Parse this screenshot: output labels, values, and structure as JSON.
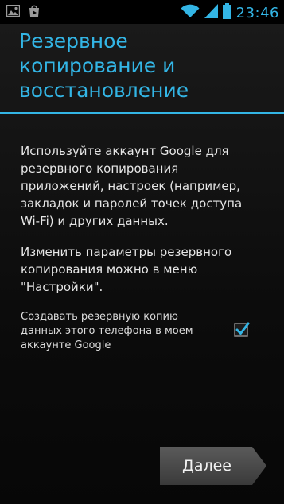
{
  "status_bar": {
    "time": "23:46",
    "left_icons": [
      "image-icon",
      "play-store-icon"
    ],
    "right_icons": [
      "wifi-icon",
      "signal-icon",
      "battery-icon"
    ],
    "accent_color": "#33b5e5"
  },
  "screen": {
    "title": "Резервное\nкопирование и\nвосстановление",
    "paragraph_1": "Используйте аккаунт Google для\nрезервного копирования\nприложений, настроек (например,\nзакладок и паролей точек доступа\nWi-Fi) и других данных.",
    "paragraph_2": "Изменить параметры резервного\nкопирования можно в меню\n\"Настройки\".",
    "backup_checkbox": {
      "label": "Создавать резервную копию\nданных этого телефона в моем\nаккаунте Google",
      "checked": true
    },
    "next_button_label": "Далее"
  }
}
